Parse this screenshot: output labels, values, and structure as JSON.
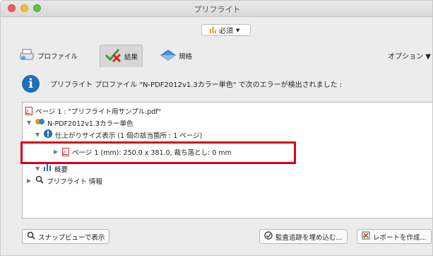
{
  "window": {
    "title": "プリフライト"
  },
  "profile_select": {
    "label": "必須"
  },
  "tabs": [
    {
      "label": "プロファイル"
    },
    {
      "label": "結果"
    },
    {
      "label": "規格"
    }
  ],
  "options_label": "オプション ▼",
  "message": "プリフライト プロファイル \"N-PDF2012v1.3カラー単色\" で次のエラーが検出されました :",
  "tree": {
    "rows": [
      {
        "text": "ページ 1 : \"プリフライト用サンプル.pdf\""
      },
      {
        "text": "N-PDF2012v1.3カラー単色"
      },
      {
        "text": "仕上がりサイズ表示 (1 個の該当箇所 : 1 ページ)"
      },
      {
        "text": "ページ 1 (mm): 250.0 x 381.0, 裁ち落とし: 0 mm"
      },
      {
        "text": "概要"
      },
      {
        "text": "プリフライト 情報"
      }
    ]
  },
  "buttons": {
    "snapshot": "スナップビューで表示",
    "embed_audit": "監査追跡を埋め込む...",
    "create_report": "レポートを作成..."
  },
  "colors": {
    "highlight": "#d6001c",
    "info": "#1f6fb8"
  }
}
